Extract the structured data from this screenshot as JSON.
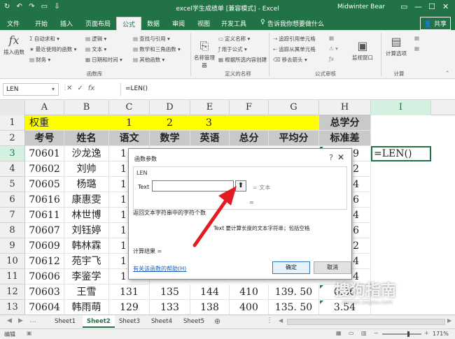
{
  "titlebar": {
    "quick_access": "↻ ↶ ↷ ▭ ⇩",
    "title": "excel学生成绩单 [兼容模式] - Excel",
    "user": "Midwinter Bear"
  },
  "menu": {
    "tabs": [
      "文件",
      "开始",
      "插入",
      "页面布局",
      "公式",
      "数据",
      "审阅",
      "视图",
      "开发工具"
    ],
    "active_tab": "公式",
    "search": "告诉我你想要做什么",
    "share": "共享"
  },
  "ribbon": {
    "insert_function": "插入函数",
    "autosum": "自动求和",
    "recent": "最近使用的函数",
    "finance": "财务",
    "logic": "逻辑",
    "text": "文本",
    "datetime": "日期和时间",
    "lookup": "查找与引用",
    "math": "数学和三角函数",
    "other": "其他函数",
    "group_library": "函数库",
    "name_manager": "名称管理器",
    "define_name": "定义名称",
    "use_in_formula": "用于公式",
    "create_from_selection": "根据所选内容创建",
    "group_names": "定义的名称",
    "trace_precedents": "追踪引用单元格",
    "trace_dependents": "追踪从属单元格",
    "remove_arrows": "移去箭头",
    "group_audit": "公式审核",
    "watch_window": "监视窗口",
    "calc_options": "计算选项",
    "group_calc": "计算"
  },
  "formula_bar": {
    "name_box": "LEN",
    "formula": "=LEN()",
    "cancel": "✕",
    "enter": "✓",
    "fx": "fx"
  },
  "sheet": {
    "columns": [
      "A",
      "B",
      "C",
      "D",
      "E",
      "F",
      "G",
      "H",
      "I"
    ],
    "selected_column": "I",
    "rows": [
      "1",
      "2",
      "3",
      "4",
      "5",
      "6",
      "7",
      "8",
      "9",
      "10",
      "11",
      "12",
      "13"
    ],
    "selected_row": "3",
    "r1": {
      "a": "权重",
      "c": "1",
      "d": "2",
      "e": "3",
      "h": "总学分"
    },
    "headers": [
      "考号",
      "姓名",
      "语文",
      "数学",
      "英语",
      "总分",
      "平均分",
      "标准差"
    ],
    "ids": [
      "70601",
      "70602",
      "70605",
      "70616",
      "70611",
      "70607",
      "70609",
      "70612",
      "70606",
      "70603",
      "70604"
    ],
    "names": [
      "沙龙逸",
      "刘帅",
      "杨璐",
      "康惠雯",
      "林世博",
      "刘钰婷",
      "韩林霖",
      "苑宇飞",
      "李鉴学",
      "王雪",
      "韩雨萌"
    ],
    "col_c_partial": [
      "1",
      "1",
      "1",
      "1",
      "1",
      "1",
      "1",
      "1",
      "1"
    ],
    "col_h_partial": [
      "9",
      "2",
      "4",
      "6",
      "4",
      "6",
      "2",
      "4",
      "4"
    ],
    "row12": {
      "c": "131",
      "d": "135",
      "e": "144",
      "f": "410",
      "g": "139. 50",
      "h": "6.36"
    },
    "row13": {
      "c": "129",
      "d": "133",
      "e": "138",
      "f": "400",
      "g": "135. 50",
      "h": "3.54"
    },
    "active_formula": "=LEN()"
  },
  "dialog": {
    "title": "函数参数",
    "help": "?",
    "close": "✕",
    "function_name": "LEN",
    "arg_label": "Text",
    "arg_value": "",
    "arg_result": "= 文本",
    "eq": "=",
    "description": "返回文本字符串中的字符个数",
    "arg_description": "Text  要计算长度的文本字符串；包括空格",
    "calc_result": "计算结果 =",
    "help_link": "有关该函数的帮助(H)",
    "ok": "确定",
    "cancel": "取消"
  },
  "sheets": {
    "tabs": [
      "Sheet1",
      "Sheet2",
      "Sheet3",
      "Sheet4",
      "Sheet5"
    ],
    "active": "Sheet2"
  },
  "status": {
    "mode": "编辑",
    "zoom": "171%"
  },
  "watermark": {
    "text": "搜狗指南",
    "url": "zhinan.sogou.com"
  },
  "colors": {
    "excel_green": "#217346",
    "highlight_yellow": "#ffff00",
    "header_gray": "#c9c9c9",
    "arrow_red": "#e31b23"
  }
}
